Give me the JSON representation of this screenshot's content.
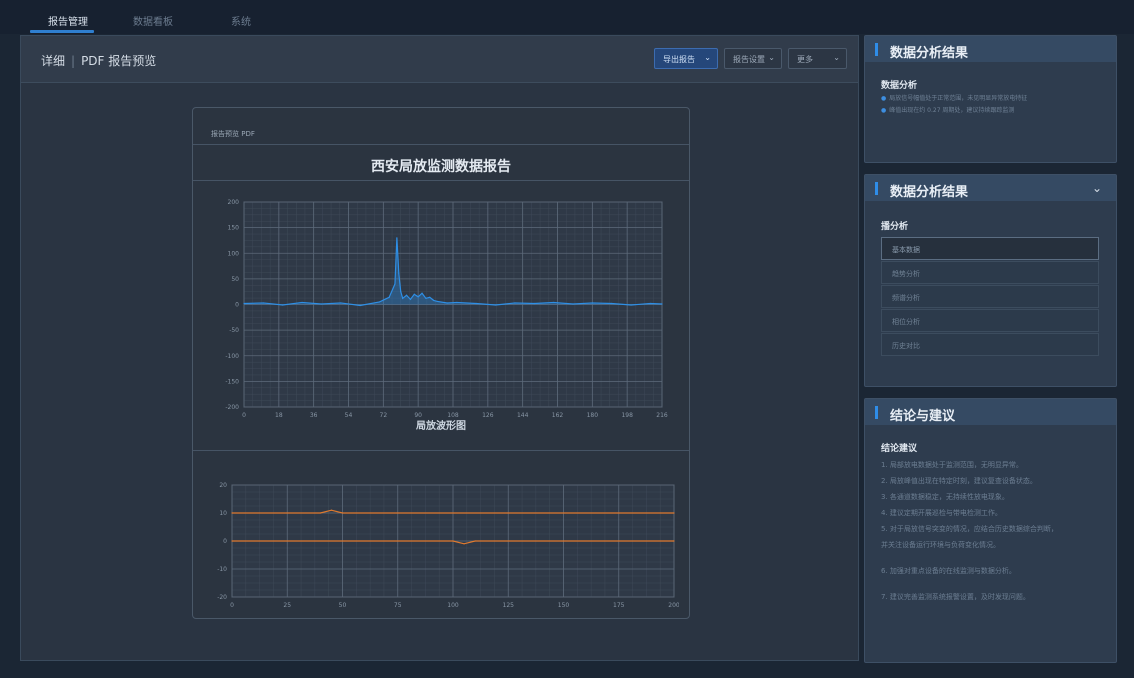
{
  "nav": {
    "tabs": [
      {
        "label": "报告管理"
      },
      {
        "label": "数据看板"
      },
      {
        "label": "系统"
      }
    ]
  },
  "header": {
    "title": "详细",
    "subtitle": "PDF 报告预览",
    "buttons": [
      {
        "label": "导出报告"
      },
      {
        "label": "报告设置"
      },
      {
        "label": "更多"
      }
    ]
  },
  "document": {
    "label": "报告预览 PDF",
    "title": "西安局放监测数据报告",
    "chart_xlabel": "局放波形图"
  },
  "panel1": {
    "title": "数据分析结果",
    "subtitle": "数据分析",
    "bullets": [
      "局放信号幅值处于正常范围，未见明显异常放电特征",
      "峰值出现在约 0.27 周期处，建议持续跟踪监测"
    ]
  },
  "panel2": {
    "title": "数据分析结果",
    "subtitle": "播分析",
    "items": [
      {
        "label": "基本数据"
      },
      {
        "label": "趋势分析"
      },
      {
        "label": "频谱分析"
      },
      {
        "label": "相位分析"
      },
      {
        "label": "历史对比"
      }
    ]
  },
  "panel3": {
    "title": "结论与建议",
    "subtitle": "结论建议",
    "lines": [
      "1. 局部放电数据处于监测范围，无明显异常。",
      "2. 局放峰值出现在特定时刻，建议复查设备状态。",
      "3. 各通道数据稳定，无持续性放电现象。",
      "4. 建议定期开展巡检与带电检测工作。",
      "5. 对于局放信号突变的情况，应结合历史数据综合判断，",
      "   并关注设备运行环境与负荷变化情况。",
      "6. 加强对重点设备的在线监测与数据分析。",
      "7. 建议完善监测系统报警设置，及时发现问题。"
    ]
  },
  "chart_data": [
    {
      "type": "line",
      "title": "",
      "xlabel": "局放波形图",
      "ylabel": "",
      "x_ticks": [
        "0",
        "18",
        "36",
        "54",
        "72",
        "90",
        "108",
        "126",
        "144",
        "162",
        "180",
        "198",
        "216"
      ],
      "y_ticks": [
        "200",
        "150",
        "100",
        "50",
        "0",
        "-50",
        "-100",
        "-150",
        "-200"
      ],
      "xlim": [
        0,
        216
      ],
      "ylim": [
        -200,
        200
      ],
      "grid": true,
      "series": [
        {
          "color": "#2e8fe6",
          "x": [
            0,
            10,
            20,
            30,
            40,
            50,
            60,
            70,
            75,
            78,
            79,
            80,
            81,
            82,
            84,
            86,
            88,
            90,
            92,
            94,
            96,
            98,
            100,
            105,
            110,
            120,
            130,
            140,
            150,
            160,
            170,
            180,
            190,
            200,
            210,
            216
          ],
          "y": [
            2,
            3,
            -1,
            4,
            1,
            3,
            -2,
            5,
            14,
            40,
            130,
            60,
            25,
            12,
            18,
            10,
            20,
            15,
            22,
            12,
            14,
            8,
            6,
            3,
            4,
            2,
            -1,
            3,
            2,
            4,
            1,
            3,
            2,
            -1,
            2,
            1
          ]
        }
      ]
    },
    {
      "type": "line",
      "title": "",
      "xlabel": "",
      "ylabel": "",
      "x_ticks": [
        "0",
        "25",
        "50",
        "75",
        "100",
        "125",
        "150",
        "175",
        "200"
      ],
      "y_ticks": [
        "20",
        "10",
        "0",
        "-10",
        "-20"
      ],
      "xlim": [
        0,
        200
      ],
      "ylim": [
        -20,
        20
      ],
      "grid": true,
      "series": [
        {
          "color": "#e07a2e",
          "x": [
            0,
            40,
            45,
            50,
            200
          ],
          "y": [
            10,
            10,
            11,
            10,
            10
          ]
        },
        {
          "color": "#e07a2e",
          "x": [
            0,
            100,
            105,
            110,
            200
          ],
          "y": [
            0,
            0,
            -1,
            0,
            0
          ]
        }
      ]
    }
  ]
}
